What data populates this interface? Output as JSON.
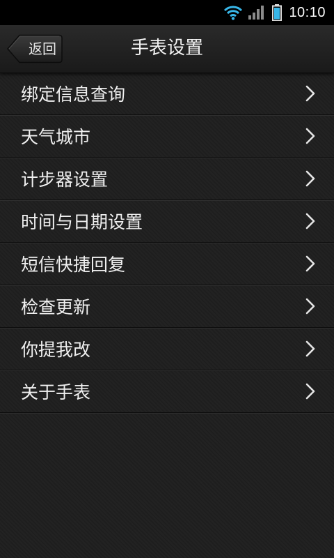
{
  "status_bar": {
    "time": "10:10",
    "icons": [
      "wifi-icon",
      "signal-icon",
      "battery-icon"
    ]
  },
  "header": {
    "back_label": "返回",
    "title": "手表设置"
  },
  "menu": {
    "items": [
      {
        "label": "绑定信息查询"
      },
      {
        "label": "天气城市"
      },
      {
        "label": "计步器设置"
      },
      {
        "label": "时间与日期设置"
      },
      {
        "label": "短信快捷回复"
      },
      {
        "label": "检查更新"
      },
      {
        "label": "你提我改"
      },
      {
        "label": "关于手表"
      }
    ],
    "chevron_icon": "chevron-right-icon"
  },
  "colors": {
    "background": "#1f1f1f",
    "status_bar": "#000000",
    "text": "#f0f0f0",
    "battery_fill": "#38b6e8"
  }
}
